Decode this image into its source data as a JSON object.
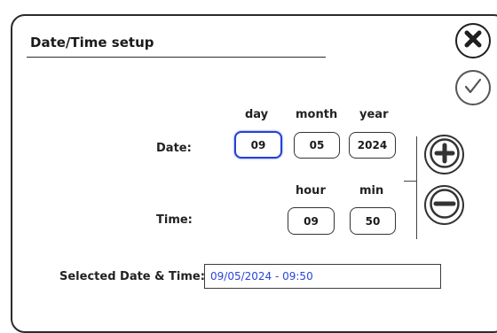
{
  "dialog": {
    "title": "Date/Time setup"
  },
  "actions": {
    "close_icon": "close-x-circle-icon",
    "confirm_icon": "checkmark-circle-icon",
    "increment_icon": "plus-circle-icon",
    "decrement_icon": "minus-circle-icon"
  },
  "date_row": {
    "label": "Date:",
    "headers": {
      "day": "day",
      "month": "month",
      "year": "year"
    },
    "values": {
      "day": "09",
      "month": "05",
      "year": "2024"
    }
  },
  "time_row": {
    "label": "Time:",
    "headers": {
      "hour": "hour",
      "min": "min"
    },
    "values": {
      "hour": "09",
      "min": "50"
    }
  },
  "selected": {
    "label": "Selected Date & Time:",
    "value": "09/05/2024 - 09:50"
  },
  "colors": {
    "focus_border": "#2342d6",
    "selected_text": "#2a46d8",
    "border": "#2b2b2b"
  }
}
